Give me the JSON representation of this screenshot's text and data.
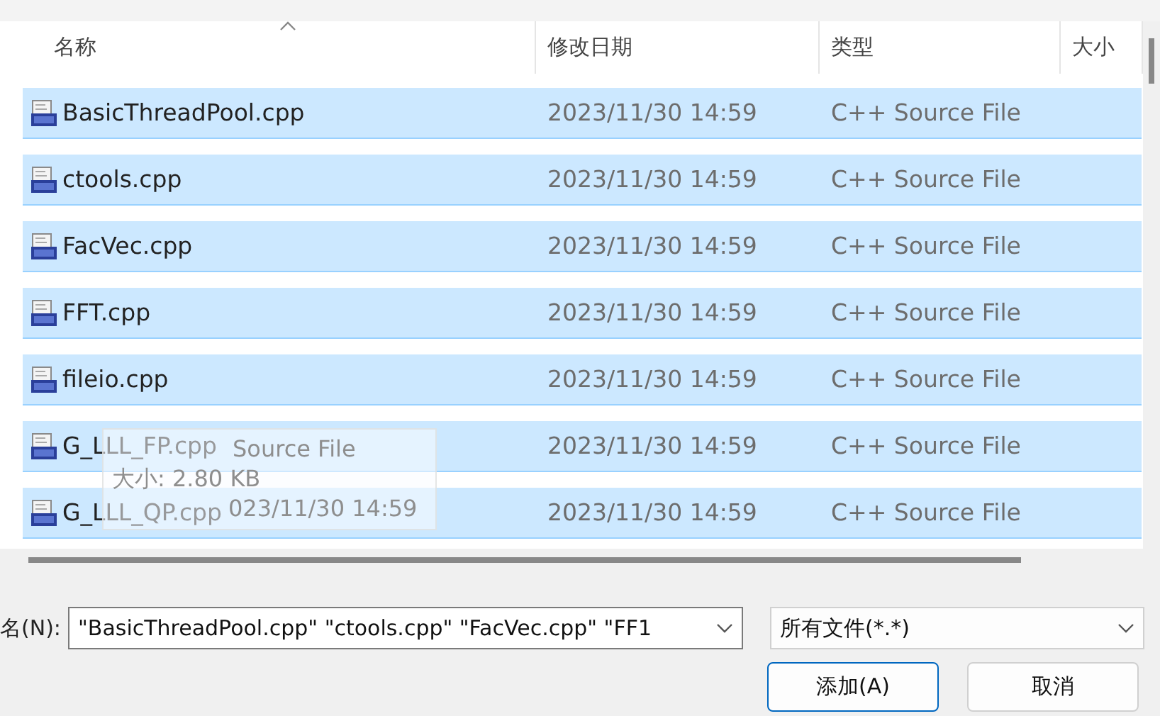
{
  "columns": [
    {
      "label": "名称",
      "sorted": true
    },
    {
      "label": "修改日期",
      "sorted": false
    },
    {
      "label": "类型",
      "sorted": false
    },
    {
      "label": "大小",
      "sorted": false
    }
  ],
  "rows": [
    {
      "name": "BasicThreadPool.cpp",
      "date": "2023/11/30 14:59",
      "type": "C++ Source File",
      "selected": true
    },
    {
      "name": "ctools.cpp",
      "date": "2023/11/30 14:59",
      "type": "C++ Source File",
      "selected": true
    },
    {
      "name": "FacVec.cpp",
      "date": "2023/11/30 14:59",
      "type": "C++ Source File",
      "selected": true
    },
    {
      "name": "FFT.cpp",
      "date": "2023/11/30 14:59",
      "type": "C++ Source File",
      "selected": true
    },
    {
      "name": "fileio.cpp",
      "date": "2023/11/30 14:59",
      "type": "C++ Source File",
      "selected": true
    },
    {
      "name": "G_LLL_FP.cpp",
      "date": "2023/11/30 14:59",
      "type": "C++ Source File",
      "selected": true
    },
    {
      "name": "G_LLL_QP.cpp",
      "date": "2023/11/30 14:59",
      "type": "C++ Source File",
      "selected": true
    }
  ],
  "tooltip": {
    "lines": [
      "Source File",
      "大小: 2.80 KB",
      "023/11/30 14:59"
    ]
  },
  "filename": {
    "label": "名(N):",
    "value": "\"BasicThreadPool.cpp\" \"ctools.cpp\" \"FacVec.cpp\" \"FF1"
  },
  "filter": {
    "value": "所有文件(*.*)"
  },
  "buttons": [
    {
      "label": "添加(A)",
      "kind": "primary"
    },
    {
      "label": "取消",
      "kind": "normal"
    }
  ]
}
